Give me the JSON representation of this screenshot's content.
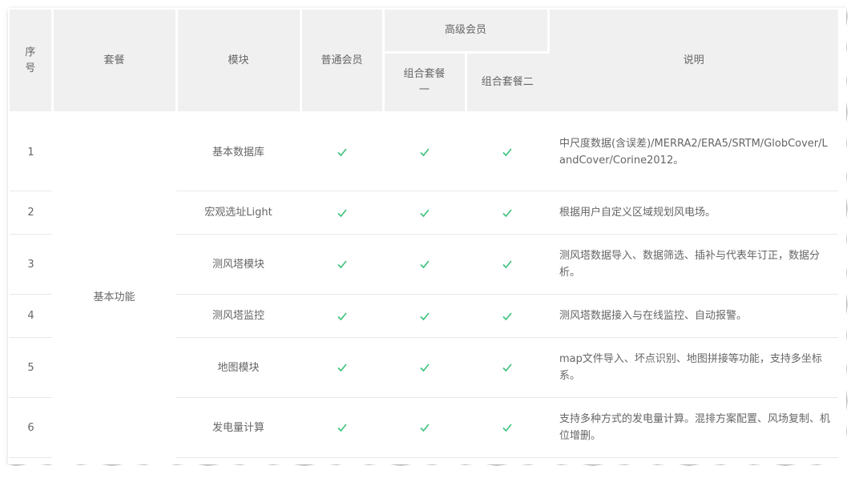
{
  "header": {
    "index": "序号",
    "package": "套餐",
    "module": "模块",
    "regular_member": "普通会员",
    "premium_member": "高级会员",
    "combo_one": "组合套餐一",
    "combo_two": "组合套餐二",
    "description": "说明"
  },
  "package_name": "基本功能",
  "icons": {
    "check": "check-icon",
    "check_color": "#3cc37a"
  },
  "rows": [
    {
      "index": "1",
      "module": "基本数据库",
      "description": "中尺度数据(含误差)/MERRA2/ERA5/SRTM/GlobCover/LandCover/Corine2012。"
    },
    {
      "index": "2",
      "module": "宏观选址Light",
      "description": "根据用户自定义区域规划风电场。"
    },
    {
      "index": "3",
      "module": "测风塔模块",
      "description": "测风塔数据导入、数据筛选、插补与代表年订正，数据分析。"
    },
    {
      "index": "4",
      "module": "测风塔监控",
      "description": "测风塔数据接入与在线监控、自动报警。"
    },
    {
      "index": "5",
      "module": "地图模块",
      "description": "map文件导入、坏点识别、地图拼接等功能，支持多坐标系。"
    },
    {
      "index": "6",
      "module": "发电量计算",
      "description": "支持多种方式的发电量计算。混排方案配置、风场复制、机位增删。"
    }
  ]
}
